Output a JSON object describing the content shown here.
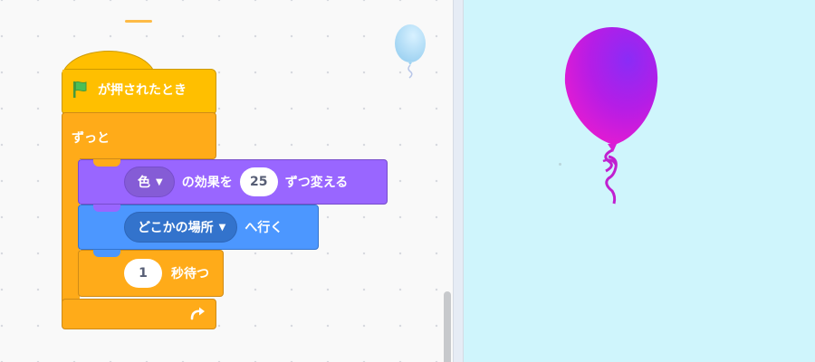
{
  "blocks": {
    "hat": {
      "label": "が押されたとき",
      "icon": "green-flag-icon",
      "color": "#ffbf00"
    },
    "forever": {
      "label": "ずっと",
      "icon": "rotate-arrow-icon",
      "color": "#ffab19"
    },
    "change_effect": {
      "effect": "色",
      "text_before": "の効果を",
      "value": "25",
      "text_after": "ずつ変える",
      "color": "#9966ff"
    },
    "go_to": {
      "target": "どこかの場所",
      "text_after": "へ行く",
      "color": "#4c97ff"
    },
    "wait": {
      "value": "1",
      "text_after": "秒待つ",
      "color": "#ffab19"
    }
  },
  "sprite_thumbnail": {
    "icon": "balloon-icon"
  },
  "stage": {
    "background": "#cff5fc",
    "sprite_icon": "balloon-icon",
    "sprite_color": "#cc22dd"
  }
}
